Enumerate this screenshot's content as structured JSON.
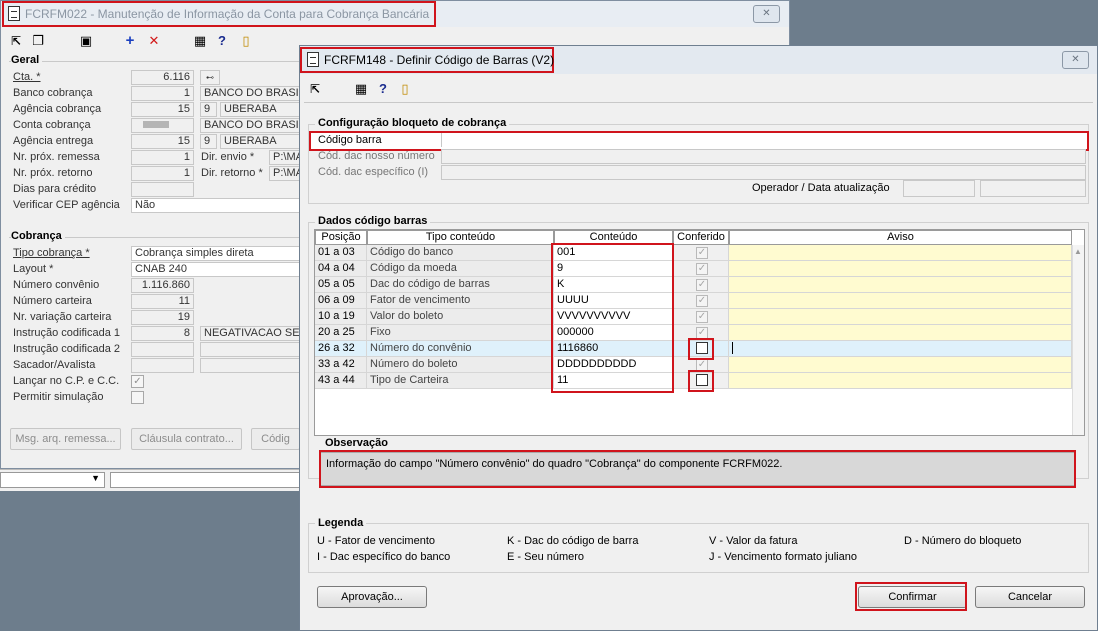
{
  "back_window": {
    "title": "FCRFM022 - Manutenção de Informação da Conta para Cobrança Bancária",
    "geral": {
      "title": "Geral",
      "cta_label": "Cta. *",
      "cta_value": "6.116",
      "banco_label": "Banco cobrança",
      "banco_num": "1",
      "banco_nome": "BANCO DO BRASIL",
      "agencia_label": "Agência cobrança",
      "agencia_num": "15",
      "agencia_dig": "9",
      "agencia_cidade": "UBERABA",
      "conta_label": "Conta cobrança",
      "conta_nome": "BANCO DO BRASIL",
      "ag_entrega_label": "Agência entrega",
      "ag_entrega_num": "15",
      "ag_entrega_dig": "9",
      "ag_entrega_cidade": "UBERABA",
      "prox_remessa_label": "Nr. próx. remessa",
      "prox_remessa_val": "1",
      "dir_envio_label": "Dir. envio *",
      "dir_envio_val": "P:\\MA",
      "prox_retorno_label": "Nr. próx. retorno",
      "prox_retorno_val": "1",
      "dir_retorno_label": "Dir. retorno *",
      "dir_retorno_val": "P:\\MA",
      "dias_credito_label": "Dias para crédito",
      "verificar_cep_label": "Verificar CEP agência",
      "verificar_cep_val": "Não"
    },
    "cobranca": {
      "title": "Cobrança",
      "tipo_label": "Tipo cobrança *",
      "tipo_val": "Cobrança simples direta",
      "layout_label": "Layout *",
      "layout_val": "CNAB 240",
      "convenio_label": "Número convênio",
      "convenio_val": "1.116.860",
      "carteira_label": "Número carteira",
      "carteira_val": "11",
      "variacao_label": "Nr. variação carteira",
      "variacao_val": "19",
      "instr1_label": "Instrução codificada 1",
      "instr1_num": "8",
      "instr1_txt": "NEGATIVACAO SEM",
      "instr2_label": "Instrução codificada 2",
      "sacador_label": "Sacador/Avalista",
      "lancar_label": "Lançar no C.P. e C.C.",
      "permitir_label": "Permitir simulação"
    },
    "buttons": {
      "msg_arq": "Msg. arq. remessa...",
      "clausula": "Cláusula contrato...",
      "codigo": "Códig"
    }
  },
  "dialog": {
    "title": "FCRFM148 - Definir Código de Barras (V2)",
    "config": {
      "title": "Configuração bloqueto de cobrança",
      "codigo_barra_label": "Código barra",
      "dac_nosso_label": "Cód. dac nosso número",
      "dac_especifico_label": "Cód. dac específico (I)",
      "operador_label": "Operador / Data atualização"
    },
    "dados": {
      "title": "Dados código barras",
      "columns": [
        "Posição",
        "Tipo conteúdo",
        "Conteúdo",
        "Conferido",
        "Aviso"
      ],
      "rows": [
        {
          "pos": "01 a 03",
          "tipo": "Código do banco",
          "conteudo": "001",
          "conferido": true
        },
        {
          "pos": "04 a 04",
          "tipo": "Código da moeda",
          "conteudo": "9",
          "conferido": true
        },
        {
          "pos": "05 a 05",
          "tipo": "Dac do código de barras",
          "conteudo": "K",
          "conferido": true
        },
        {
          "pos": "06 a 09",
          "tipo": "Fator de vencimento",
          "conteudo": "UUUU",
          "conferido": true
        },
        {
          "pos": "10 a 19",
          "tipo": "Valor do boleto",
          "conteudo": "VVVVVVVVVV",
          "conferido": true
        },
        {
          "pos": "20 a 25",
          "tipo": "Fixo",
          "conteudo": "000000",
          "conferido": true
        },
        {
          "pos": "26 a 32",
          "tipo": "Número do convênio",
          "conteudo": "1116860",
          "conferido": false
        },
        {
          "pos": "33 a 42",
          "tipo": "Número do boleto",
          "conteudo": "DDDDDDDDDD",
          "conferido": true
        },
        {
          "pos": "43 a 44",
          "tipo": "Tipo de Carteira",
          "conteudo": "11",
          "conferido": false
        }
      ]
    },
    "observacao": {
      "title": "Observação",
      "text": "Informação do campo \"Número convênio\" do quadro \"Cobrança\" do componente FCRFM022."
    },
    "legenda": {
      "title": "Legenda",
      "items": [
        "U - Fator de vencimento",
        "K - Dac do código de barra",
        "V - Valor da fatura",
        "D - Número do bloqueto",
        "I - Dac específico do banco",
        "E - Seu número",
        "J - Vencimento formato juliano"
      ]
    },
    "buttons": {
      "aprovacao": "Aprovação...",
      "confirmar": "Confirmar",
      "cancelar": "Cancelar"
    }
  },
  "colors": {
    "highlight": "#d0141c",
    "aviso_bg": "#fffbd0",
    "selected_row": "#dff1fb"
  }
}
